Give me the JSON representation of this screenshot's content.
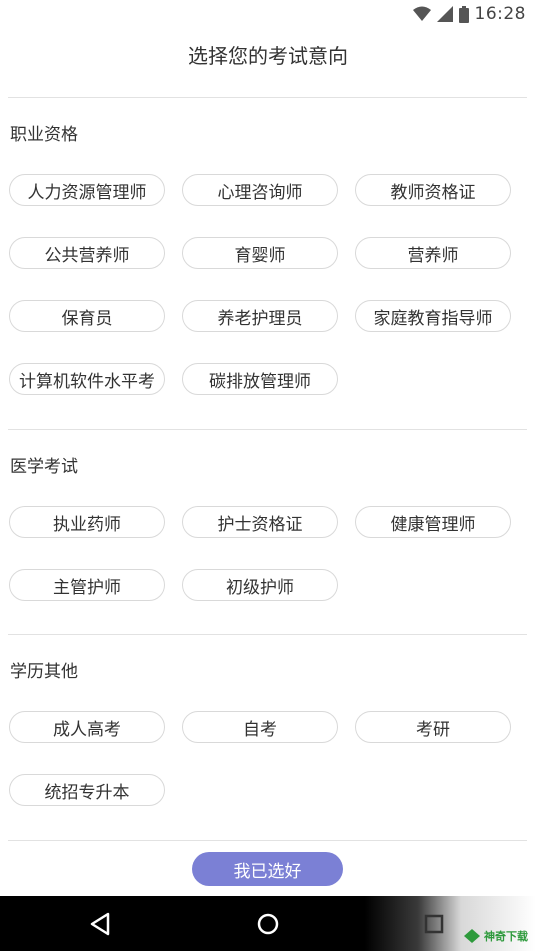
{
  "status_bar": {
    "time": "16:28",
    "icons": [
      "wifi-icon",
      "signal-icon",
      "battery-icon"
    ]
  },
  "title": "选择您的考试意向",
  "sections": [
    {
      "title": "职业资格",
      "chips": [
        "人力资源管理师",
        "心理咨询师",
        "教师资格证",
        "公共营养师",
        "育婴师",
        "营养师",
        "保育员",
        "养老护理员",
        "家庭教育指导师",
        "计算机软件水平考",
        "碳排放管理师"
      ]
    },
    {
      "title": "医学考试",
      "chips": [
        "执业药师",
        "护士资格证",
        "健康管理师",
        "主管护师",
        "初级护师"
      ]
    },
    {
      "title": "学历其他",
      "chips": [
        "成人高考",
        "自考",
        "考研",
        "统招专升本"
      ]
    }
  ],
  "confirm_label": "我已选好",
  "nav": [
    "back-icon",
    "home-icon",
    "recents-icon"
  ],
  "watermark": "神奇下载",
  "colors": {
    "accent": "#7b80d5",
    "chip_border": "#d9d9d9",
    "divider": "#e2e2e2"
  }
}
